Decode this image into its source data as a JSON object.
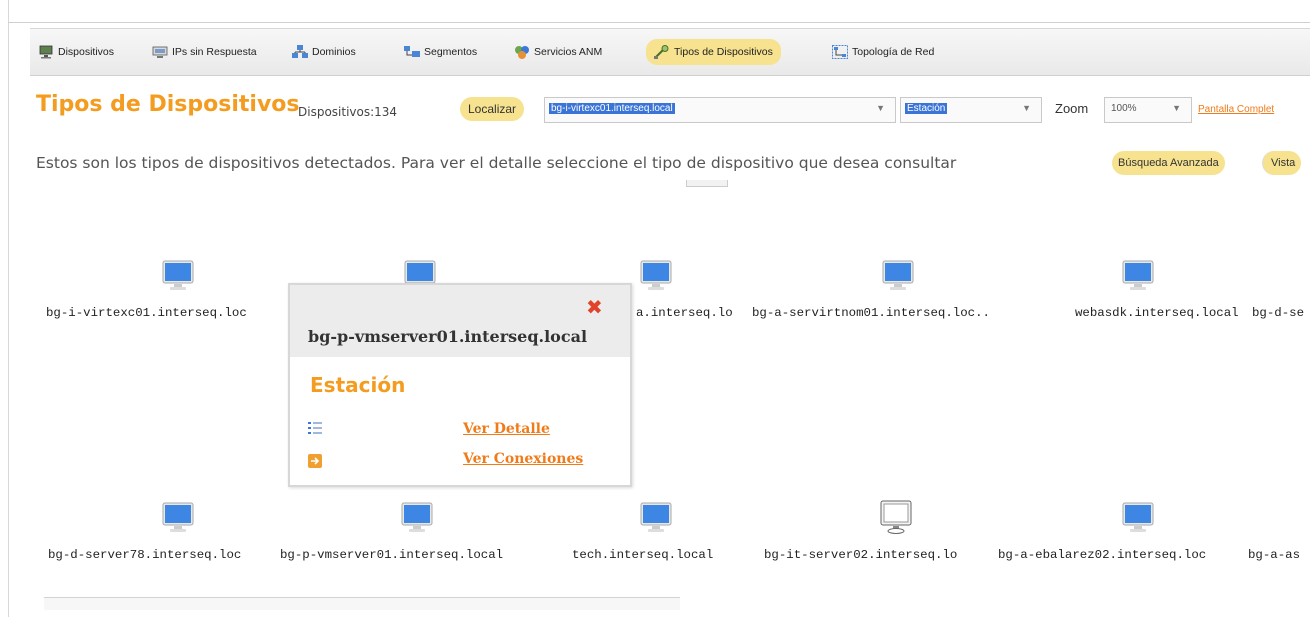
{
  "toolbar": {
    "items": [
      {
        "label": "Dispositivos",
        "icon": "monitor-network-icon"
      },
      {
        "label": "IPs sin Respuesta",
        "icon": "monitor-warning-icon"
      },
      {
        "label": "Dominios",
        "icon": "domain-network-icon"
      },
      {
        "label": "Segmentos",
        "icon": "segments-icon"
      },
      {
        "label": "Servicios ANM",
        "icon": "services-icon"
      },
      {
        "label": "Tipos de Dispositivos",
        "icon": "device-types-icon",
        "active": true
      },
      {
        "label": "Topología de Red",
        "icon": "topology-icon"
      }
    ]
  },
  "header": {
    "title": "Tipos de Dispositivos",
    "count": "Dispositivos:134",
    "localizar_label": "Localizar",
    "localizar_value": "bg-i-virtexc01.interseq.local",
    "type_value": "Estación",
    "zoom_label": "Zoom",
    "zoom_value": "100%",
    "fullscreen_link": "Pantalla Complet"
  },
  "description": "Estos son los tipos de dispositivos detectados. Para ver el detalle seleccione el tipo de dispositivo que desea consultar",
  "buttons": {
    "advanced_search": "Búsqueda Avanzada",
    "vista": "Vista"
  },
  "devices_row1": [
    "bg-i-virtexc01.interseq.loc",
    "",
    "a.interseq.lo",
    "bg-a-servirtnom01.interseq.loc..",
    "webasdk.interseq.local",
    "bg-d-se"
  ],
  "devices_row2": [
    "bg-d-server78.interseq.loc",
    "bg-p-vmserver01.interseq.local",
    "tech.interseq.local",
    "bg-it-server02.interseq.lo",
    "bg-a-ebalarez02.interseq.loc",
    "bg-a-as"
  ],
  "popup": {
    "hostname": "bg-p-vmserver01.interseq.local",
    "type": "Estación",
    "link_detail": "Ver Detalle",
    "link_connections": "Ver Conexiones"
  },
  "colors": {
    "accent": "#f39c1f",
    "link": "#f07b18",
    "highlight": "#f7e28f",
    "monitor": "#3d86e4",
    "close": "#e1432a"
  }
}
